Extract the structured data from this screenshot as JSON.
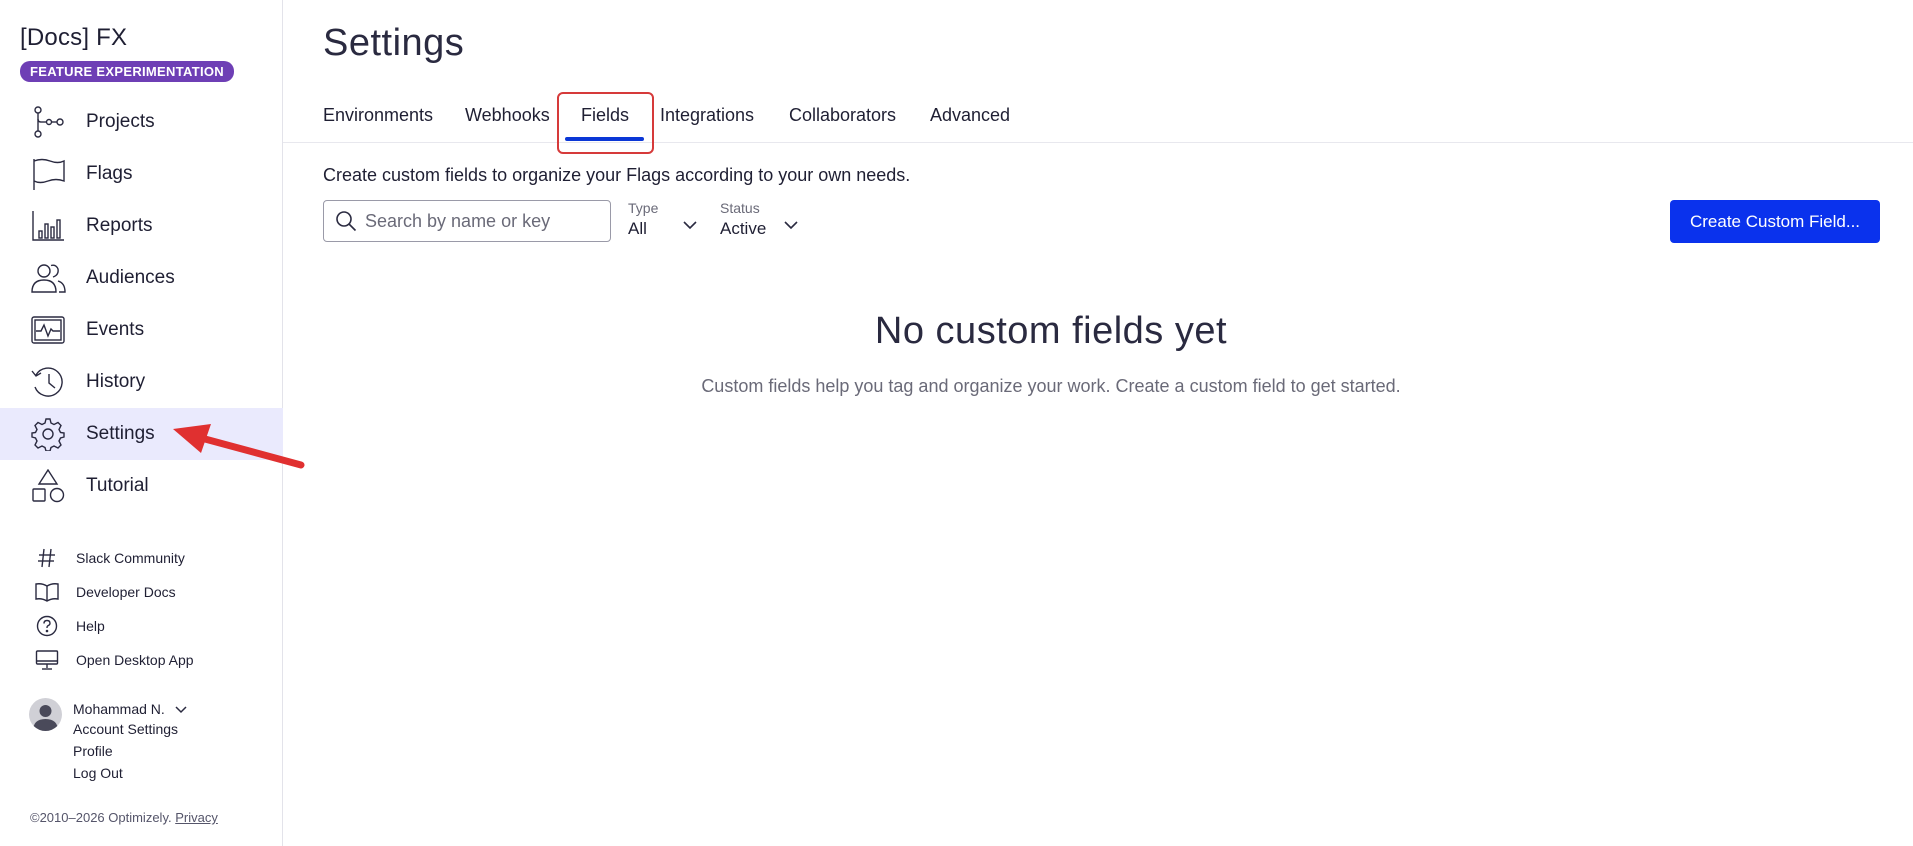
{
  "brand": {
    "title": "[Docs] FX",
    "badge": "FEATURE EXPERIMENTATION"
  },
  "nav": {
    "items": [
      {
        "label": "Projects",
        "icon": "projects-icon"
      },
      {
        "label": "Flags",
        "icon": "flag-icon"
      },
      {
        "label": "Reports",
        "icon": "reports-icon"
      },
      {
        "label": "Audiences",
        "icon": "audiences-icon"
      },
      {
        "label": "Events",
        "icon": "events-icon"
      },
      {
        "label": "History",
        "icon": "history-icon"
      },
      {
        "label": "Settings",
        "icon": "gear-icon",
        "active": true
      },
      {
        "label": "Tutorial",
        "icon": "shapes-icon"
      }
    ]
  },
  "util": {
    "items": [
      {
        "label": "Slack Community",
        "icon": "hash-icon"
      },
      {
        "label": "Developer Docs",
        "icon": "book-icon"
      },
      {
        "label": "Help",
        "icon": "help-icon"
      },
      {
        "label": "Open Desktop App",
        "icon": "desktop-icon"
      }
    ]
  },
  "user": {
    "name": "Mohammad N.",
    "links": [
      "Account Settings",
      "Profile",
      "Log Out"
    ]
  },
  "footer": {
    "copyright": "©2010–2026 Optimizely.",
    "privacy": "Privacy"
  },
  "main": {
    "title": "Settings",
    "tabs": [
      {
        "label": "Environments"
      },
      {
        "label": "Webhooks"
      },
      {
        "label": "Fields",
        "active": true
      },
      {
        "label": "Integrations"
      },
      {
        "label": "Collaborators"
      },
      {
        "label": "Advanced"
      }
    ],
    "description": "Create custom fields to organize your Flags according to your own needs.",
    "search": {
      "placeholder": "Search by name or key",
      "value": ""
    },
    "filters": {
      "type": {
        "label": "Type",
        "value": "All"
      },
      "status": {
        "label": "Status",
        "value": "Active"
      }
    },
    "create_button": "Create Custom Field...",
    "empty": {
      "title": "No custom fields yet",
      "subtitle": "Custom fields help you tag and organize your work. Create a custom field to get started."
    }
  },
  "colors": {
    "accent": "#0a32ed",
    "badge": "#6e3fb5",
    "active_nav_bg": "#eaeafd",
    "tab_underline": "#0b37d6",
    "annotation_red": "#e03030"
  }
}
